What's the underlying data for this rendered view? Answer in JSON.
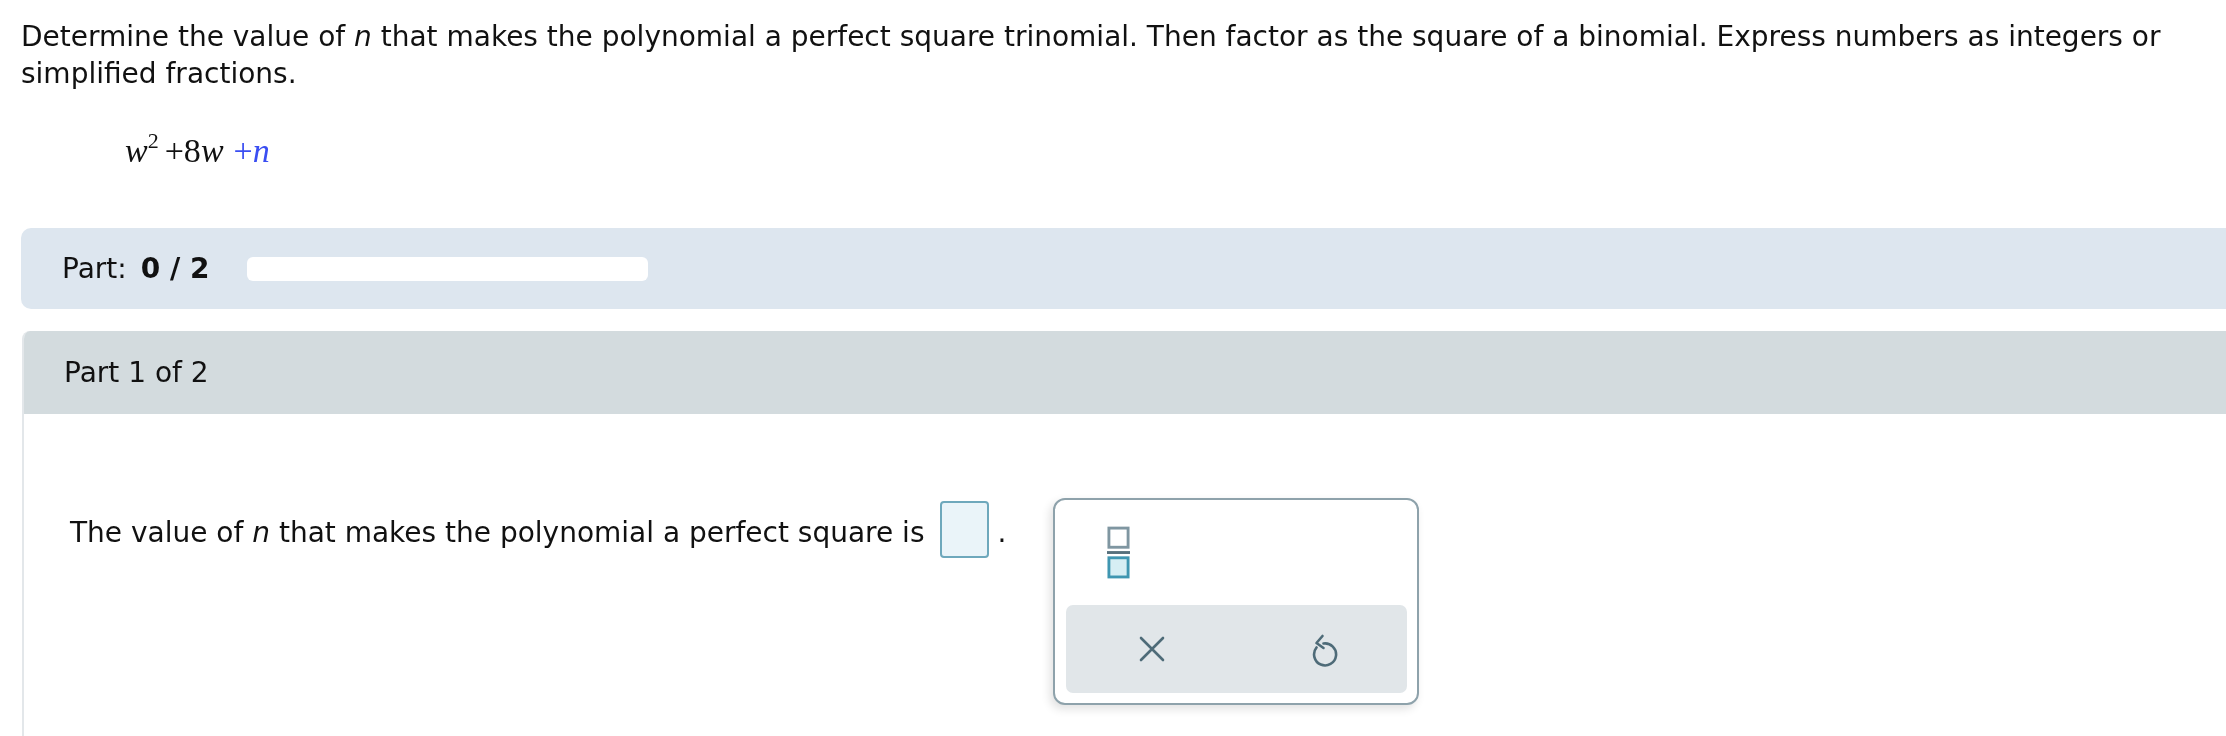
{
  "instruction": "Determine the value of *n* that makes the polynomial a perfect square trinomial. Then factor as the square of a binomial. Express numbers as integers or simplified fractions.",
  "expression": [
    {
      "kind": "variable",
      "text": "w$^{2}$"
    },
    {
      "kind": "constant",
      "text": "+8"
    },
    {
      "kind": "variable",
      "text": "w"
    },
    {
      "kind": "unknown",
      "text": "+*n*"
    }
  ],
  "progress": {
    "label": "Part:",
    "value": "0 / 2",
    "level": 0
  },
  "part": {
    "title": "Part 1 of 2",
    "prompt": [
      {
        "kind": "text",
        "text": "The value of *n* that makes the polynomial a perfect square is"
      },
      {
        "kind": "answer_box"
      },
      {
        "kind": "text",
        "text": "."
      }
    ]
  },
  "palette": {
    "templates": [
      {
        "kind": "fraction"
      }
    ],
    "actions": [
      {
        "kind": "clear"
      },
      {
        "kind": "undo"
      }
    ]
  }
}
